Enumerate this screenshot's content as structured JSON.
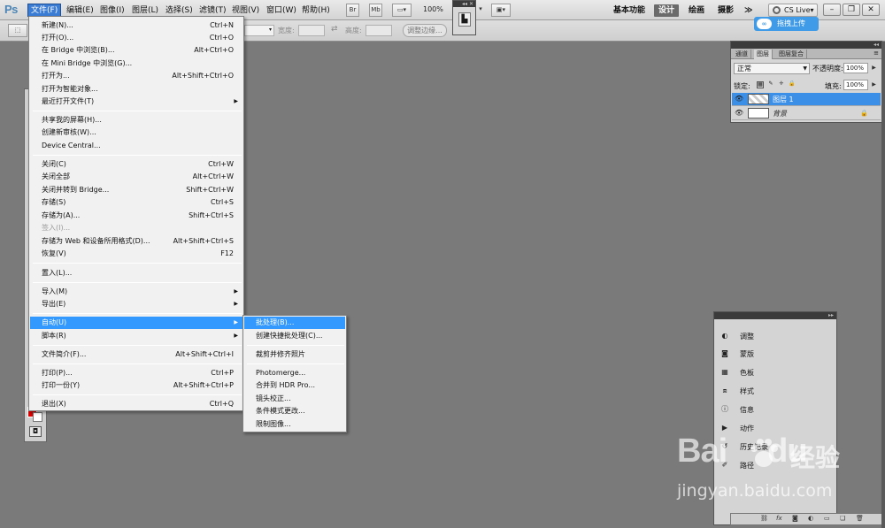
{
  "app": {
    "logo": "Ps",
    "menus": [
      "文件(F)",
      "编辑(E)",
      "图像(I)",
      "图层(L)",
      "选择(S)",
      "滤镜(T)",
      "视图(V)",
      "窗口(W)",
      "帮助(H)"
    ],
    "zoom": "100%",
    "workspaces": [
      "基本功能",
      "设计",
      "绘画",
      "摄影"
    ],
    "more": "≫",
    "cslive": "CS Live"
  },
  "options": {
    "width_label": "宽度:",
    "height_label": "高度:",
    "refine_edge": "调整边缘..."
  },
  "upload_button": "拖拽上传",
  "file_menu": [
    {
      "label": "新建(N)...",
      "shortcut": "Ctrl+N"
    },
    {
      "label": "打开(O)...",
      "shortcut": "Ctrl+O"
    },
    {
      "label": "在 Bridge 中浏览(B)...",
      "shortcut": "Alt+Ctrl+O"
    },
    {
      "label": "在 Mini Bridge 中浏览(G)...",
      "shortcut": ""
    },
    {
      "label": "打开为...",
      "shortcut": "Alt+Shift+Ctrl+O"
    },
    {
      "label": "打开为智能对象...",
      "shortcut": ""
    },
    {
      "label": "最近打开文件(T)",
      "shortcut": ""
    },
    {
      "label": "共享我的屏幕(H)...",
      "shortcut": ""
    },
    {
      "label": "创建新审核(W)...",
      "shortcut": ""
    },
    {
      "label": "Device Central...",
      "shortcut": ""
    },
    {
      "label": "关闭(C)",
      "shortcut": "Ctrl+W"
    },
    {
      "label": "关闭全部",
      "shortcut": "Alt+Ctrl+W"
    },
    {
      "label": "关闭并转到 Bridge...",
      "shortcut": "Shift+Ctrl+W"
    },
    {
      "label": "存储(S)",
      "shortcut": "Ctrl+S"
    },
    {
      "label": "存储为(A)...",
      "shortcut": "Shift+Ctrl+S"
    },
    {
      "label": "签入(I)...",
      "shortcut": ""
    },
    {
      "label": "存储为 Web 和设备所用格式(D)...",
      "shortcut": "Alt+Shift+Ctrl+S"
    },
    {
      "label": "恢复(V)",
      "shortcut": "F12"
    },
    {
      "label": "置入(L)...",
      "shortcut": ""
    },
    {
      "label": "导入(M)",
      "shortcut": ""
    },
    {
      "label": "导出(E)",
      "shortcut": ""
    },
    {
      "label": "自动(U)",
      "shortcut": ""
    },
    {
      "label": "脚本(R)",
      "shortcut": ""
    },
    {
      "label": "文件简介(F)...",
      "shortcut": "Alt+Shift+Ctrl+I"
    },
    {
      "label": "打印(P)...",
      "shortcut": "Ctrl+P"
    },
    {
      "label": "打印一份(Y)",
      "shortcut": "Alt+Shift+Ctrl+P"
    },
    {
      "label": "退出(X)",
      "shortcut": "Ctrl+Q"
    }
  ],
  "automate_menu": [
    "批处理(B)...",
    "创建快捷批处理(C)...",
    "裁剪并修齐照片",
    "Photomerge...",
    "合并到 HDR Pro...",
    "镜头校正...",
    "条件模式更改...",
    "限制图像..."
  ],
  "layers": {
    "tabs": [
      "通道",
      "图层",
      "图层复合"
    ],
    "blend_mode": "正常",
    "opacity_label": "不透明度:",
    "opacity": "100%",
    "lock_label": "锁定:",
    "fill_label": "填充:",
    "fill": "100%",
    "rows": [
      {
        "name": "图层 1",
        "selected": true
      },
      {
        "name": "背景",
        "selected": false
      }
    ]
  },
  "dock": [
    "调整",
    "蒙版",
    "色板",
    "样式",
    "信息",
    "动作",
    "历史记录",
    "路径"
  ],
  "watermark": {
    "logo": "Bai",
    "du": "du",
    "cn": "经验",
    "url": "jingyan.baidu.com"
  },
  "colors": {
    "highlight": "#3399ff",
    "foreground_swatch": "#e00000",
    "background_swatch": "#ffffff",
    "canvas": "#7a7a7a"
  }
}
